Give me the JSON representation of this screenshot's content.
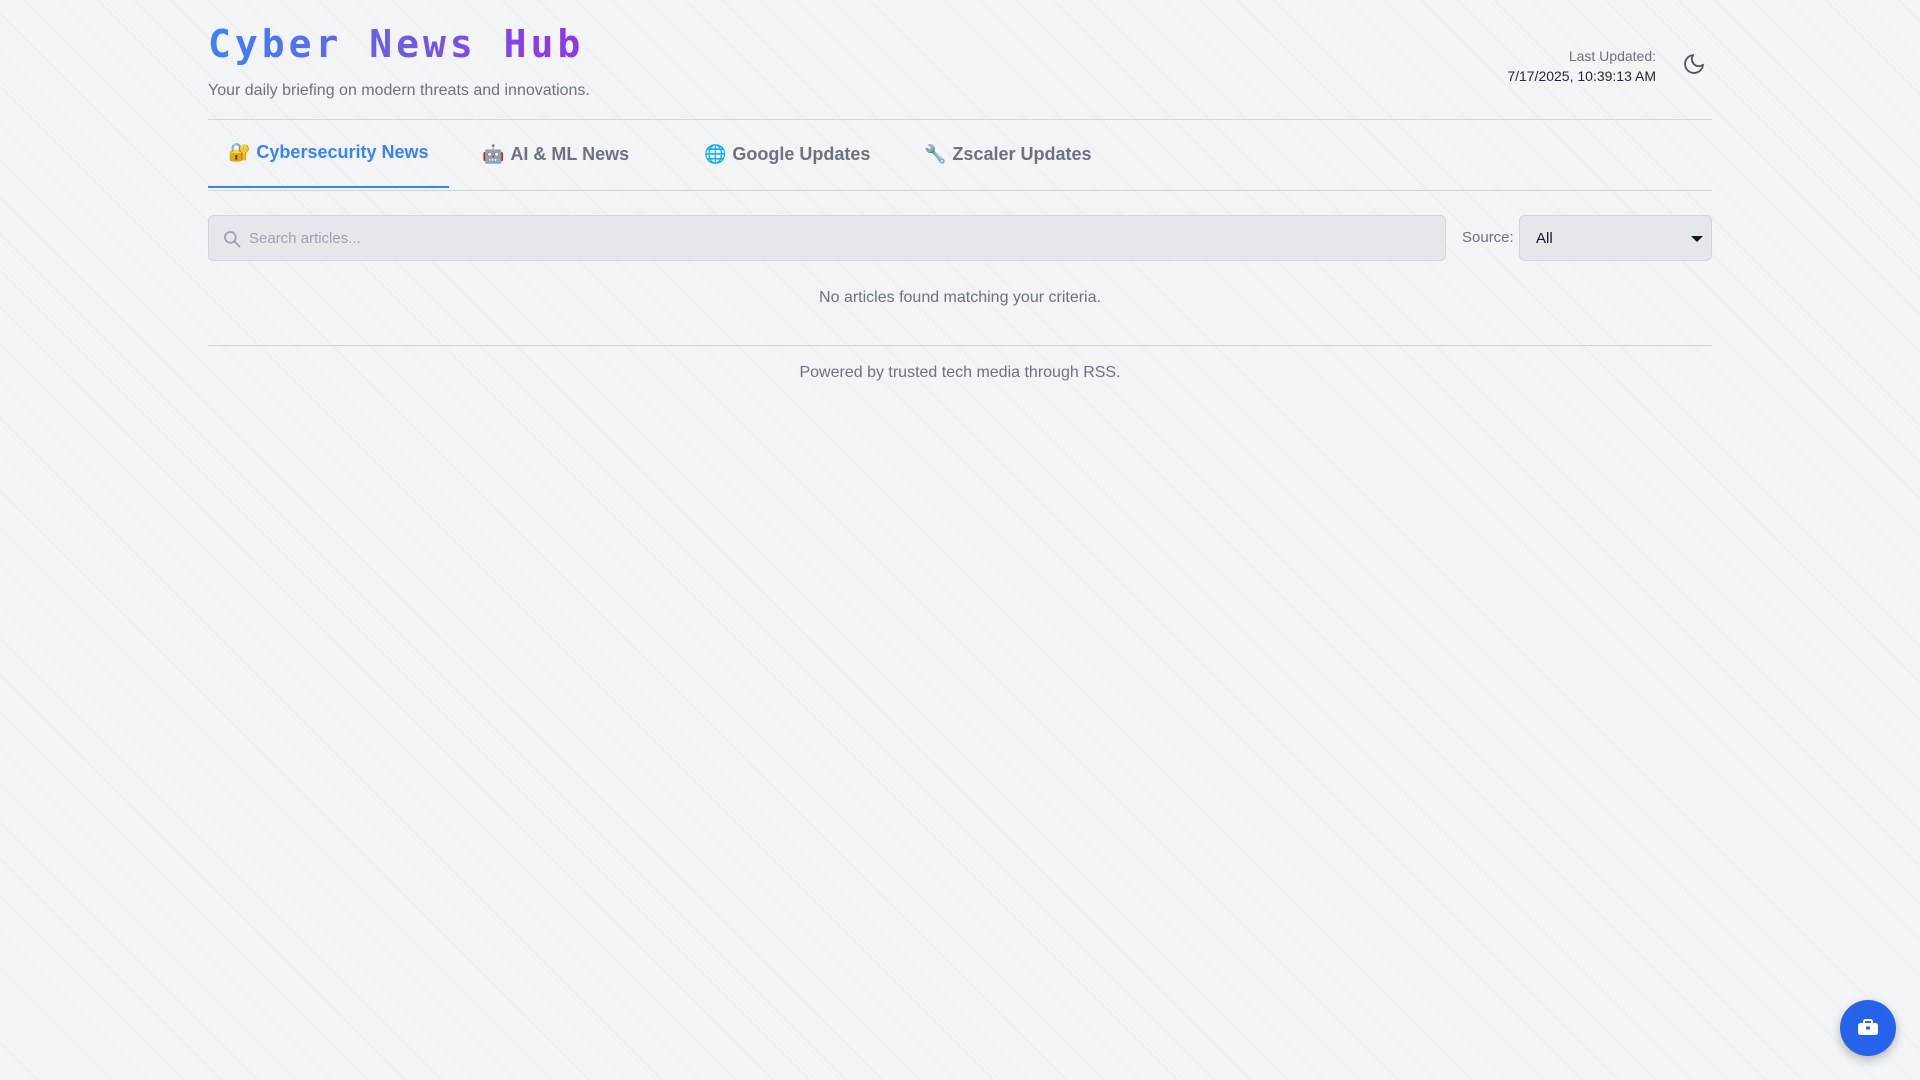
{
  "header": {
    "title": "Cyber News Hub",
    "subtitle": "Your daily briefing on modern threats and innovations.",
    "last_updated_label": "Last Updated:",
    "last_updated_value": "7/17/2025, 10:39:13 AM",
    "theme_toggle_icon": "moon-icon"
  },
  "tabs": [
    {
      "emoji": "🔐",
      "label": "Cybersecurity News",
      "active": true
    },
    {
      "emoji": "🤖",
      "label": "AI & ML News",
      "active": false
    },
    {
      "emoji": "🌐",
      "label": "Google Updates",
      "active": false
    },
    {
      "emoji": "🔧",
      "label": "Zscaler Updates",
      "active": false
    }
  ],
  "search": {
    "placeholder": "Search articles...",
    "value": "",
    "icon": "search-icon"
  },
  "source_filter": {
    "label": "Source:",
    "selected": "All"
  },
  "empty_message": "No articles found matching your criteria.",
  "footer": {
    "text": "Powered by trusted tech media through RSS."
  },
  "fab": {
    "icon": "toolbox-icon",
    "color": "#2563eb"
  },
  "colors": {
    "accent": "#3b82f6",
    "title_gradient_start": "#3b82f6",
    "title_gradient_end": "#9333ea"
  }
}
